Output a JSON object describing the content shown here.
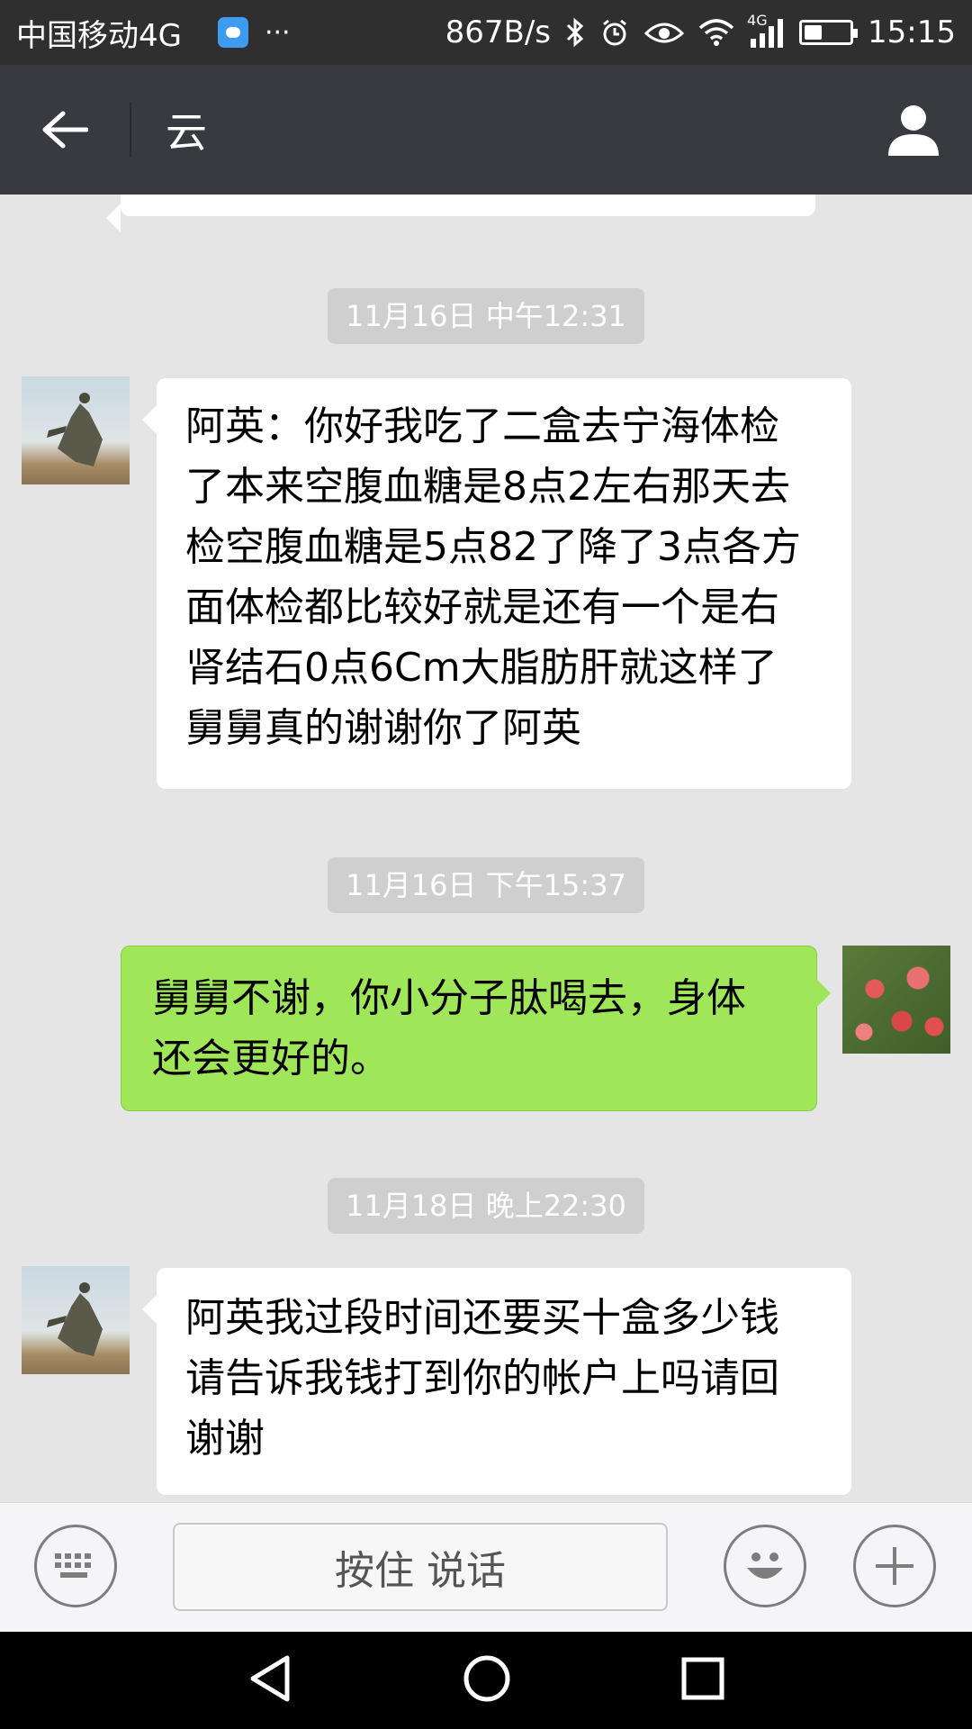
{
  "status_bar": {
    "carrier": "中国移动4G",
    "more": "···",
    "speed": "867B/s",
    "network": "4G",
    "time": "15:15"
  },
  "header": {
    "title": "云"
  },
  "messages": [
    {
      "type": "timestamp",
      "text": "11月16日 中午12:31"
    },
    {
      "type": "incoming",
      "lines": [
        "阿英：你好我吃了二盒去宁海体检",
        "了本来空腹血糖是8点2左右那天去",
        "检空腹血糖是5点82了降了3点各方",
        "面体检都比较好就是还有一个是右",
        "肾结石0点6Cm大脂肪肝就这样了",
        "舅舅真的谢谢你了阿英"
      ]
    },
    {
      "type": "timestamp",
      "text": "11月16日 下午15:37"
    },
    {
      "type": "outgoing",
      "lines": [
        "舅舅不谢，你小分子肽喝去，身体",
        "还会更好的。"
      ]
    },
    {
      "type": "timestamp",
      "text": "11月18日 晚上22:30"
    },
    {
      "type": "incoming",
      "lines": [
        "阿英我过段时间还要买十盒多少钱",
        "请告诉我钱打到你的帐户上吗请回",
        "谢谢"
      ]
    }
  ],
  "input_bar": {
    "hold_to_talk": "按住 说话"
  },
  "icons": {
    "back": "arrow-left-icon",
    "profile": "person-icon",
    "keyboard": "keyboard-icon",
    "emoji": "smiley-icon",
    "more": "plus-icon"
  },
  "colors": {
    "header_bg": "#393a3f",
    "chat_bg": "#e5e5e5",
    "outgoing_bubble": "#9fe658",
    "incoming_bubble": "#ffffff"
  }
}
